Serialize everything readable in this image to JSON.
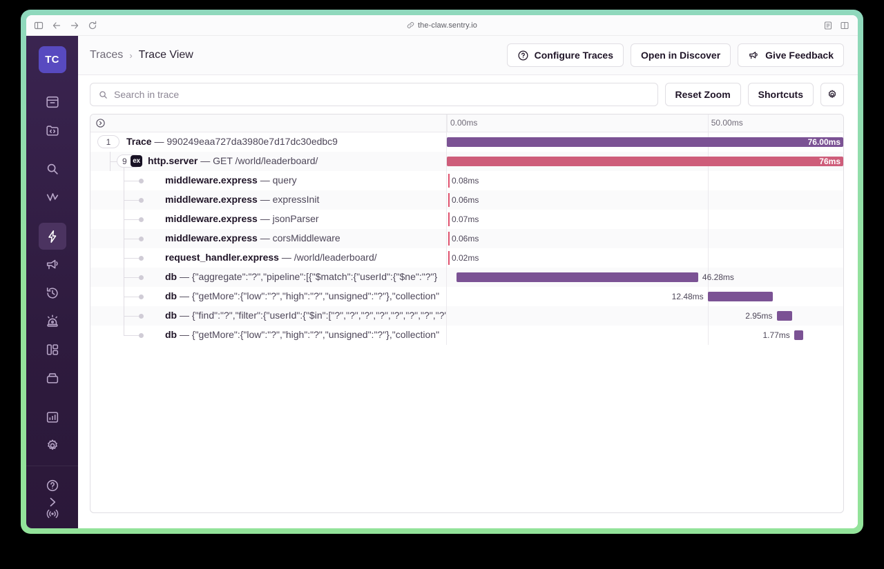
{
  "browser": {
    "url": "the-claw.sentry.io",
    "url_icon": "link-icon",
    "back_icon": "arrow-left-icon",
    "forward_icon": "arrow-right-icon",
    "reload_icon": "reload-icon",
    "sidebar_toggle_icon": "sidebar-toggle-icon",
    "reader_icon": "reader-view-icon",
    "tabs_icon": "tab-overview-icon"
  },
  "sidebar": {
    "avatar": "TC",
    "items": [
      {
        "name": "sidebar-item-issues",
        "icon": "issues-icon"
      },
      {
        "name": "sidebar-item-projects",
        "icon": "code-folder-icon"
      },
      {
        "name": "sidebar-item-discover",
        "icon": "search-icon"
      },
      {
        "name": "sidebar-item-insights",
        "icon": "vitals-graph-icon"
      },
      {
        "name": "sidebar-item-performance",
        "icon": "lightning-icon",
        "active": true
      },
      {
        "name": "sidebar-item-user-feedback",
        "icon": "megaphone-icon"
      },
      {
        "name": "sidebar-item-replays",
        "icon": "history-clock-icon"
      },
      {
        "name": "sidebar-item-alerts",
        "icon": "siren-icon"
      },
      {
        "name": "sidebar-item-dashboards",
        "icon": "dashboard-icon"
      },
      {
        "name": "sidebar-item-releases",
        "icon": "releases-box-icon"
      },
      {
        "name": "sidebar-item-stats",
        "icon": "bar-chart-icon"
      },
      {
        "name": "sidebar-item-settings",
        "icon": "gear-icon"
      },
      {
        "name": "sidebar-item-help",
        "icon": "question-circle-icon"
      },
      {
        "name": "sidebar-item-broadcasts",
        "icon": "broadcast-icon"
      }
    ],
    "expand_icon": "chevron-right-icon"
  },
  "header": {
    "breadcrumb_root": "Traces",
    "breadcrumb_separator": "›",
    "breadcrumb_current": "Trace View",
    "configure_traces_label": "Configure Traces",
    "configure_traces_icon": "question-circle-icon",
    "open_in_discover_label": "Open in Discover",
    "give_feedback_label": "Give Feedback",
    "give_feedback_icon": "megaphone-icon"
  },
  "toolbar": {
    "search_placeholder": "Search in trace",
    "search_value": "",
    "search_icon": "search-icon",
    "reset_zoom_label": "Reset Zoom",
    "shortcuts_label": "Shortcuts",
    "settings_icon": "gear-icon"
  },
  "trace": {
    "expand_all_icon": "circle-chevron-right-icon",
    "ticks": [
      {
        "label": "0.00ms",
        "pct": 0
      },
      {
        "label": "50.00ms",
        "pct": 65.8
      }
    ],
    "rows": [
      {
        "name": "trace-root-row",
        "pill": "1",
        "pill_caret": false,
        "badge": null,
        "op": "Trace",
        "dash": "—",
        "desc": "990249eaa727da3980e7d17dc30edbc9",
        "indent": 0,
        "duration": "76.00ms",
        "bar_start_pct": 0,
        "bar_width_pct": 100,
        "bar_color": "purple",
        "label_inside": true,
        "connector": false
      },
      {
        "name": "span-row-http-server",
        "pill": "9",
        "pill_caret": true,
        "badge": "ex",
        "op": "http.server",
        "dash": "—",
        "desc": "GET /world/leaderboard/",
        "indent": 1,
        "duration": "76ms",
        "bar_start_pct": 0,
        "bar_width_pct": 100,
        "bar_color": "pink",
        "label_inside": true,
        "connector": true
      },
      {
        "name": "span-row-middleware-query",
        "pill": null,
        "badge": null,
        "op": "middleware.express",
        "dash": "—",
        "desc": "query",
        "indent": 2,
        "duration": "0.08ms",
        "bar_start_pct": 0,
        "bar_width_pct": 0.3,
        "bar_color": "zero",
        "label_inside": false,
        "connector": true
      },
      {
        "name": "span-row-middleware-expressinit",
        "pill": null,
        "badge": null,
        "op": "middleware.express",
        "dash": "—",
        "desc": "expressInit",
        "indent": 2,
        "duration": "0.06ms",
        "bar_start_pct": 0,
        "bar_width_pct": 0.3,
        "bar_color": "zero",
        "label_inside": false,
        "connector": true
      },
      {
        "name": "span-row-middleware-jsonparser",
        "pill": null,
        "badge": null,
        "op": "middleware.express",
        "dash": "—",
        "desc": "jsonParser",
        "indent": 2,
        "duration": "0.07ms",
        "bar_start_pct": 0,
        "bar_width_pct": 0.3,
        "bar_color": "zero",
        "label_inside": false,
        "connector": true
      },
      {
        "name": "span-row-middleware-corsmiddleware",
        "pill": null,
        "badge": null,
        "op": "middleware.express",
        "dash": "—",
        "desc": "corsMiddleware",
        "indent": 2,
        "duration": "0.06ms",
        "bar_start_pct": 0,
        "bar_width_pct": 0.3,
        "bar_color": "zero",
        "label_inside": false,
        "connector": true
      },
      {
        "name": "span-row-request-handler",
        "pill": null,
        "badge": null,
        "op": "request_handler.express",
        "dash": "—",
        "desc": "/world/leaderboard/",
        "indent": 2,
        "duration": "0.02ms",
        "bar_start_pct": 0,
        "bar_width_pct": 0.3,
        "bar_color": "zero",
        "label_inside": false,
        "connector": true
      },
      {
        "name": "span-row-db-aggregate",
        "pill": null,
        "badge": null,
        "op": "db",
        "dash": "—",
        "desc": "{\"aggregate\":\"?\",\"pipeline\":[{\"$match\":{\"userId\":{\"$ne\":\"?\"}",
        "indent": 2,
        "duration": "46.28ms",
        "bar_start_pct": 2.5,
        "bar_width_pct": 60.9,
        "bar_color": "purple",
        "label_inside": false,
        "connector": true
      },
      {
        "name": "span-row-db-getmore-1",
        "pill": null,
        "badge": null,
        "op": "db",
        "dash": "—",
        "desc": "{\"getMore\":{\"low\":\"?\",\"high\":\"?\",\"unsigned\":\"?\"},\"collection\"",
        "indent": 2,
        "duration": "12.48ms",
        "bar_start_pct": 65.8,
        "bar_width_pct": 16.4,
        "bar_color": "purple",
        "label_inside": false,
        "connector": true
      },
      {
        "name": "span-row-db-find",
        "pill": null,
        "badge": null,
        "op": "db",
        "dash": "—",
        "desc": "{\"find\":\"?\",\"filter\":{\"userId\":{\"$in\":[\"?\",\"?\",\"?\",\"?\",\"?\",\"?\",\"?\",\"?\",\"?\",\"",
        "indent": 2,
        "duration": "2.95ms",
        "bar_start_pct": 83.2,
        "bar_width_pct": 3.9,
        "bar_color": "purple",
        "label_inside": false,
        "connector": true
      },
      {
        "name": "span-row-db-getmore-2",
        "pill": null,
        "badge": null,
        "op": "db",
        "dash": "—",
        "desc": "{\"getMore\":{\"low\":\"?\",\"high\":\"?\",\"unsigned\":\"?\"},\"collection\"",
        "indent": 2,
        "duration": "1.77ms",
        "bar_start_pct": 87.6,
        "bar_width_pct": 2.3,
        "bar_color": "purple",
        "label_inside": false,
        "connector": true
      }
    ]
  },
  "colors": {
    "trace_purple": "#7b5294",
    "span_pink": "#ce5d7a",
    "sidebar_bg": "#2e1b3e",
    "accent": "#6c5fc7",
    "window_border": "#93e39a"
  }
}
